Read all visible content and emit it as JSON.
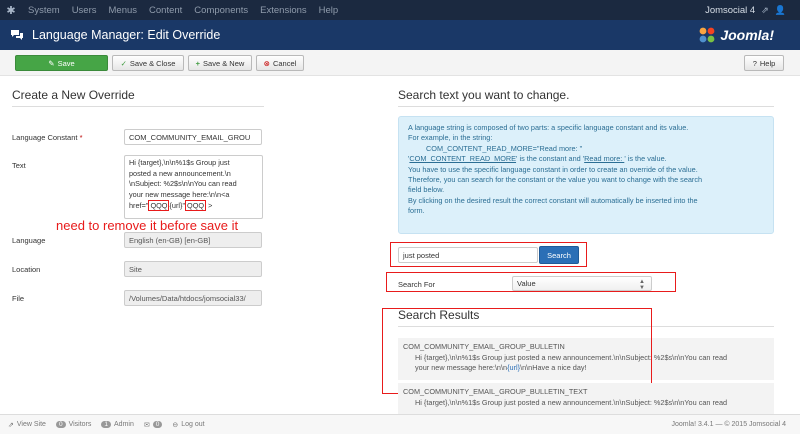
{
  "topbar": {
    "menu": [
      "System",
      "Users",
      "Menus",
      "Content",
      "Components",
      "Extensions",
      "Help"
    ],
    "site_name": "Jomsocial 4",
    "site_icon": "external-link-icon",
    "user_icon": "user-icon"
  },
  "titlebar": {
    "title": "Language Manager: Edit Override",
    "title_icon": "comments-icon",
    "brand": "Joomla!"
  },
  "toolbar": {
    "save": "Save",
    "save_close": "Save & Close",
    "save_new": "Save & New",
    "cancel": "Cancel",
    "help": "Help"
  },
  "left": {
    "heading": "Create a New Override",
    "constant_label": "Language Constant",
    "required_mark": "*",
    "constant_value": "COM_COMMUNITY_EMAIL_GROU",
    "text_label": "Text",
    "text_lines": [
      "Hi {target},\\n\\n%1$s Group just",
      "posted a new announcement.\\n",
      "\\nSubject: %2$s\\n\\nYou can read",
      "your new message here:\\n\\n<a"
    ],
    "text_last_prefix": "href=\"",
    "text_hl1": "QQQ",
    "text_mid": "{url}\"",
    "text_hl2": "QQQ",
    "text_last_suffix": " >",
    "annotation": "need to remove it before save it",
    "language_label": "Language",
    "language_value": "English (en-GB) [en-GB]",
    "location_label": "Location",
    "location_value": "Site",
    "file_label": "File",
    "file_value": "/Volumes/Data/htdocs/jomsocial33/"
  },
  "right": {
    "heading": "Search text you want to change.",
    "info": {
      "line1": "A language string is composed of two parts: a specific language constant and its value.",
      "line2": "For example, in the string:",
      "line3": "COM_CONTENT_READ_MORE=\"Read more: \"",
      "line4a": "'",
      "line4_const": "COM_CONTENT_READ_MORE",
      "line4b": "' is the constant and '",
      "line4_val": "Read more: ",
      "line4c": "' is the value.",
      "line5": "You have to use the specific language constant in order to create an override of the value.",
      "line6": "Therefore, you can search for the constant or the value you want to change with the search",
      "line7": "field below.",
      "line8": "By clicking on the desired result the correct constant will automatically be inserted into the",
      "line9": "form."
    },
    "search_value": "just posted",
    "search_button": "Search",
    "search_for_label": "Search For",
    "search_for_value": "Value",
    "results_heading": "Search Results",
    "results": [
      {
        "constant": "COM_COMMUNITY_EMAIL_GROUP_BULLETIN",
        "line1": "Hi {target},\\n\\n%1$s Group just posted a new announcement.\\n\\nSubject: %2$s\\n\\nYou can read",
        "line2a": "your new message here:\\n\\n",
        "line2_url": "{url}",
        "line2b": "\\n\\nHave a nice day!"
      },
      {
        "constant": "COM_COMMUNITY_EMAIL_GROUP_BULLETIN_TEXT",
        "line1": "Hi {target},\\n\\n%1$s Group just posted a new announcement.\\n\\nSubject: %2$s\\n\\nYou can read"
      }
    ]
  },
  "statusbar": {
    "view_site": "View Site",
    "visitors_count": "0",
    "visitors": "Visitors",
    "admin_count": "1",
    "admin": "Admin",
    "messages_count": "0",
    "logout": "Log out",
    "version": "Joomla! 3.4.1 — © 2015 Jomsocial 4"
  },
  "colors": {
    "topbar": "#1b2940",
    "titlebar": "#1a3867",
    "save_green": "#46a546",
    "search_blue": "#2b6fb6",
    "annotation_red": "#e81b1b",
    "info_bg": "#dcf0fa"
  }
}
